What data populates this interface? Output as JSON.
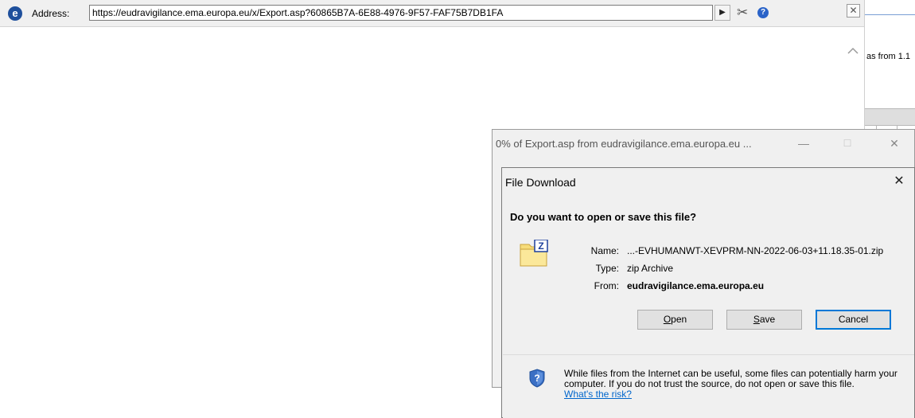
{
  "address_bar": {
    "logo": "ie-e-icon",
    "logo_glyph": "e",
    "label": "Address:",
    "url": "https://eudravigilance.ema.europa.eu/x/Export.asp?60865B7A-6E88-4976-9F57-FAF75B7DB1FA",
    "go_glyph": "▶",
    "tools_glyph": "✂",
    "help_glyph": "?",
    "close_glyph": "✕"
  },
  "background_window": {
    "text": "as from 1.1",
    "scroll_up_glyph": "^"
  },
  "progress_window": {
    "title": "0% of Export.asp from eudravigilance.ema.europa.eu ...",
    "minimize_glyph": "—",
    "maximize_glyph": "☐",
    "close_glyph": "✕"
  },
  "file_download": {
    "title": "File Download",
    "close_glyph": "✕",
    "question": "Do you want to open or save this file?",
    "fields": {
      "name_label": "Name:",
      "name_value": "...-EVHUMANWT-XEVPRM-NN-2022-06-03+11.18.35-01.zip",
      "type_label": "Type:",
      "type_value": "zip Archive",
      "from_label": "From:",
      "from_value": "eudravigilance.ema.europa.eu"
    },
    "buttons": {
      "open_key": "O",
      "open_rest": "pen",
      "save_key": "S",
      "save_rest": "ave",
      "cancel": "Cancel"
    },
    "warning": {
      "text": "While files from the Internet can be useful, some files can potentially harm your computer. If you do not trust the source, do not open or save this file.",
      "link": "What's the risk?"
    },
    "colors": {
      "link": "#0066cc",
      "default_button_border": "#0078d7"
    }
  }
}
